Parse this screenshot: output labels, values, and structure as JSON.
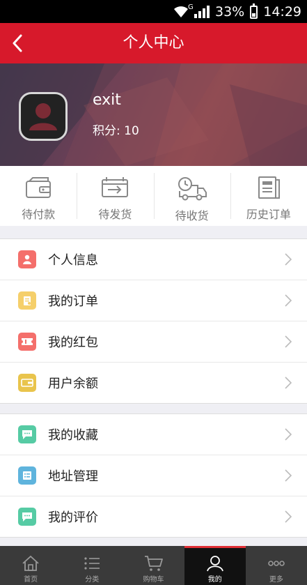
{
  "status_bar": {
    "network": "G",
    "battery": "33%",
    "time": "14:29"
  },
  "header": {
    "title": "个人中心"
  },
  "profile": {
    "username": "exit",
    "points": "积分: 10"
  },
  "orders": [
    {
      "label": "待付款",
      "icon": "wallet-icon"
    },
    {
      "label": "待发货",
      "icon": "box-icon"
    },
    {
      "label": "待收货",
      "icon": "delivery-truck-icon"
    },
    {
      "label": "历史订单",
      "icon": "history-document-icon"
    }
  ],
  "menu_group_1": [
    {
      "label": "个人信息",
      "icon": "person-info-icon",
      "color": "#f46f6b"
    },
    {
      "label": "我的订单",
      "icon": "order-clipboard-icon",
      "color": "#f5cf6a"
    },
    {
      "label": "我的红包",
      "icon": "ticket-icon",
      "color": "#f46f6b"
    },
    {
      "label": "用户余额",
      "icon": "wallet-card-icon",
      "color": "#e9c44c"
    }
  ],
  "menu_group_2": [
    {
      "label": "我的收藏",
      "icon": "chat-bubble-icon",
      "color": "#56cba4"
    },
    {
      "label": "地址管理",
      "icon": "address-list-icon",
      "color": "#5fb4dd"
    },
    {
      "label": "我的评价",
      "icon": "comment-icon",
      "color": "#56cba4"
    }
  ],
  "tabbar": [
    {
      "label": "首页",
      "icon": "home-icon"
    },
    {
      "label": "分类",
      "icon": "category-list-icon"
    },
    {
      "label": "购物车",
      "icon": "cart-icon"
    },
    {
      "label": "我的",
      "icon": "user-icon",
      "active": true
    },
    {
      "label": "更多",
      "icon": "more-dots-icon"
    }
  ],
  "colors": {
    "accent": "#d7192b",
    "tabbar_bg": "#3a3a3a"
  }
}
